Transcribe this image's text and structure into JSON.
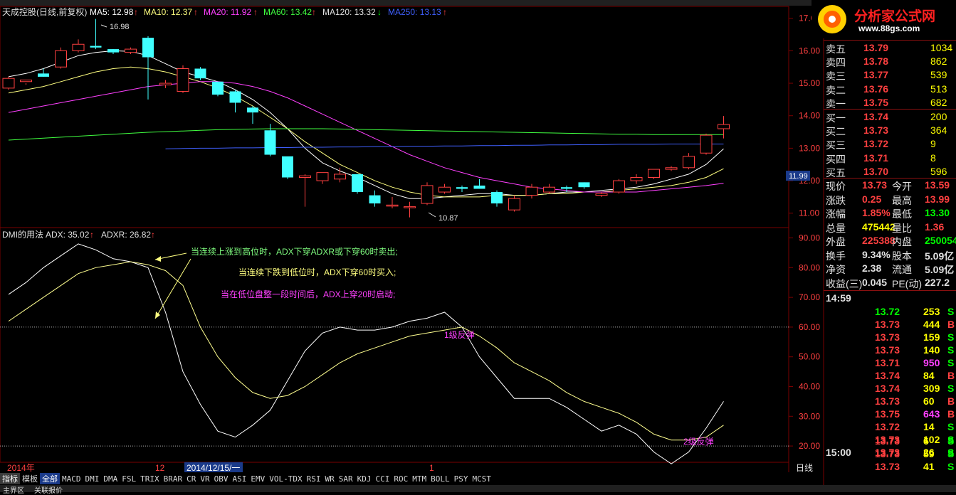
{
  "window": {
    "main_title_prefix": "天成控股(日线,前复权)",
    "ma5": "MA5: 12.98",
    "ma10": "MA10: 12.37",
    "ma20": "MA20: 11.92",
    "ma60": "MA60: 13.42",
    "ma120": "MA120: 13.32",
    "ma250": "MA250: 13.13",
    "sub_title": "DMI的用法",
    "adx": "ADX: 35.02",
    "adxr": "ADXR: 26.82"
  },
  "logo": {
    "text": "分析家公式网",
    "url": "www.88gs.com"
  },
  "annotations": {
    "max_price": "16.98",
    "min_price": "10.87",
    "cur_price_tag": "11.99",
    "note1": "当连续上涨到高位时，ADX下穿ADXR或下穿60时卖出;",
    "note2": "当连续下跌到低位时，ADX下穿60时买入;",
    "note3": "当在低位盘整一段时间后，ADX上穿20时启动;",
    "label_fantan1": "1级反弹",
    "label_fantan2": "2级反弹"
  },
  "axis": {
    "price_ticks": [
      "17.00",
      "16.00",
      "15.00",
      "14.00",
      "13.00",
      "12.00",
      "11.00"
    ],
    "dmi_ticks": [
      "90.00",
      "80.00",
      "70.00",
      "60.00",
      "50.00",
      "40.00",
      "30.00",
      "20.00"
    ],
    "x_labels": {
      "year": "2014年",
      "month12": "12",
      "date_sel": "2014/12/15/一",
      "month1": "1",
      "period": "日线"
    }
  },
  "toolbar": [
    "指标",
    "模板",
    "全部",
    "MACD",
    "DMI",
    "DMA",
    "FSL",
    "TRIX",
    "BRAR",
    "CR",
    "VR",
    "OBV",
    "ASI",
    "EMV",
    "VOL-TDX",
    "RSI",
    "WR",
    "SAR",
    "KDJ",
    "CCI",
    "ROC",
    "MTM",
    "BOLL",
    "PSY",
    "MCST"
  ],
  "bottombar": {
    "left1": "主界区",
    "left2": "关联报价"
  },
  "quote": {
    "sell": [
      {
        "label": "卖五",
        "price": "13.79",
        "vol": "1034"
      },
      {
        "label": "卖四",
        "price": "13.78",
        "vol": "862"
      },
      {
        "label": "卖三",
        "price": "13.77",
        "vol": "539"
      },
      {
        "label": "卖二",
        "price": "13.76",
        "vol": "513"
      },
      {
        "label": "卖一",
        "price": "13.75",
        "vol": "682"
      }
    ],
    "buy": [
      {
        "label": "买一",
        "price": "13.74",
        "vol": "200"
      },
      {
        "label": "买二",
        "price": "13.73",
        "vol": "364"
      },
      {
        "label": "买三",
        "price": "13.72",
        "vol": "9"
      },
      {
        "label": "买四",
        "price": "13.71",
        "vol": "8"
      },
      {
        "label": "买五",
        "price": "13.70",
        "vol": "596"
      }
    ],
    "stats": [
      {
        "l1": "现价",
        "v1": "13.73",
        "l2": "今开",
        "v2": "13.59",
        "c1": "#ff4040",
        "c2": "#ff4040"
      },
      {
        "l1": "涨跌",
        "v1": "0.25",
        "l2": "最高",
        "v2": "13.99",
        "c1": "#ff4040",
        "c2": "#ff4040"
      },
      {
        "l1": "涨幅",
        "v1": "1.85%",
        "l2": "最低",
        "v2": "13.30",
        "c1": "#ff4040",
        "c2": "#00ff00"
      },
      {
        "l1": "总量",
        "v1": "475442",
        "l2": "量比",
        "v2": "1.36",
        "c1": "#ffff00",
        "c2": "#ff4040"
      },
      {
        "l1": "外盘",
        "v1": "225388",
        "l2": "内盘",
        "v2": "250054",
        "c1": "#ff4040",
        "c2": "#00ff00"
      },
      {
        "l1": "换手",
        "v1": "9.34%",
        "l2": "股本",
        "v2": "5.09亿",
        "c1": "#e0e0e0",
        "c2": "#e0e0e0"
      },
      {
        "l1": "净资",
        "v1": "2.38",
        "l2": "流通",
        "v2": "5.09亿",
        "c1": "#e0e0e0",
        "c2": "#e0e0e0"
      },
      {
        "l1": "收益(三)",
        "v1": "0.045",
        "l2": "PE(动)",
        "v2": "227.2",
        "c1": "#e0e0e0",
        "c2": "#e0e0e0"
      }
    ],
    "ticks_time1": "14:59",
    "ticks_time2": "15:00",
    "ticks": [
      {
        "p": "13.72",
        "v": "253",
        "s": "S",
        "pc": "#00ff00",
        "vc": "#ffff00",
        "sc": "#00ff00"
      },
      {
        "p": "13.73",
        "v": "444",
        "s": "B",
        "pc": "#ff4040",
        "vc": "#ffff00",
        "sc": "#ff4040"
      },
      {
        "p": "13.73",
        "v": "159",
        "s": "S",
        "pc": "#ff4040",
        "vc": "#ffff00",
        "sc": "#00ff00"
      },
      {
        "p": "13.73",
        "v": "140",
        "s": "S",
        "pc": "#ff4040",
        "vc": "#ffff00",
        "sc": "#00ff00"
      },
      {
        "p": "13.71",
        "v": "950",
        "s": "S",
        "pc": "#ff4040",
        "vc": "#ff40ff",
        "sc": "#00ff00"
      },
      {
        "p": "13.74",
        "v": "84",
        "s": "B",
        "pc": "#ff4040",
        "vc": "#ffff00",
        "sc": "#ff4040"
      },
      {
        "p": "13.74",
        "v": "309",
        "s": "S",
        "pc": "#ff4040",
        "vc": "#ffff00",
        "sc": "#00ff00"
      },
      {
        "p": "13.73",
        "v": "60",
        "s": "B",
        "pc": "#ff4040",
        "vc": "#ffff00",
        "sc": "#ff4040"
      },
      {
        "p": "13.75",
        "v": "643",
        "s": "B",
        "pc": "#ff4040",
        "vc": "#ff40ff",
        "sc": "#ff4040"
      },
      {
        "p": "13.72",
        "v": "14",
        "s": "S",
        "pc": "#ff4040",
        "vc": "#ffff00",
        "sc": "#00ff00"
      },
      {
        "p": "13.73",
        "v": "102",
        "s": "S",
        "pc": "#ff4040",
        "vc": "#ffff00",
        "sc": "#00ff00"
      },
      {
        "p": "13.73",
        "v": "26",
        "s": "S",
        "pc": "#ff4040",
        "vc": "#ffff00",
        "sc": "#00ff00"
      },
      {
        "p": "13.73",
        "v": "6",
        "s": "S",
        "pc": "#ff4040",
        "vc": "#ffff00",
        "sc": "#00ff00"
      },
      {
        "p": "13.73",
        "v": "59",
        "s": "S",
        "pc": "#ff4040",
        "vc": "#ffff00",
        "sc": "#00ff00"
      },
      {
        "p": "13.73",
        "v": "41",
        "s": "S",
        "pc": "#ff4040",
        "vc": "#ffff00",
        "sc": "#00ff00"
      }
    ]
  },
  "chart_data": [
    {
      "type": "candlestick",
      "ylim": [
        10.6,
        17.3
      ],
      "series": [
        {
          "name": "K",
          "candles": [
            [
              14.85,
              15.2,
              14.8,
              15.15
            ],
            [
              15.05,
              15.0,
              14.95,
              15.1
            ],
            [
              15.3,
              15.45,
              15.2,
              15.2
            ],
            [
              15.5,
              16.1,
              15.45,
              16.0
            ],
            [
              16.0,
              16.35,
              15.95,
              16.2
            ],
            [
              16.15,
              16.98,
              16.05,
              16.1
            ],
            [
              16.05,
              16.05,
              15.9,
              15.95
            ],
            [
              15.95,
              16.1,
              15.9,
              16.05
            ],
            [
              16.4,
              16.45,
              14.5,
              15.8
            ],
            [
              14.95,
              15.1,
              14.85,
              15.0
            ],
            [
              14.75,
              15.55,
              14.7,
              15.45
            ],
            [
              15.45,
              15.5,
              15.1,
              15.15
            ],
            [
              15.05,
              15.0,
              14.6,
              14.65
            ],
            [
              14.75,
              14.8,
              14.1,
              14.4
            ],
            [
              14.25,
              14.3,
              13.75,
              14.1
            ],
            [
              13.55,
              13.75,
              12.75,
              12.8
            ],
            [
              12.75,
              12.7,
              12.05,
              12.1
            ],
            [
              12.1,
              12.2,
              11.2,
              12.15
            ],
            [
              12.0,
              12.2,
              11.9,
              12.25
            ],
            [
              12.05,
              12.4,
              11.95,
              12.2
            ],
            [
              12.2,
              12.2,
              11.6,
              11.65
            ],
            [
              11.55,
              11.7,
              11.2,
              11.3
            ],
            [
              11.25,
              11.5,
              11.15,
              11.25
            ],
            [
              11.2,
              11.35,
              10.87,
              11.2
            ],
            [
              11.3,
              11.95,
              11.25,
              11.85
            ],
            [
              11.65,
              11.9,
              11.6,
              11.8
            ],
            [
              11.8,
              11.85,
              11.65,
              11.75
            ],
            [
              11.85,
              12.05,
              11.75,
              11.75
            ],
            [
              11.65,
              11.7,
              11.2,
              11.3
            ],
            [
              11.1,
              11.55,
              11.05,
              11.45
            ],
            [
              11.55,
              11.9,
              11.45,
              11.8
            ],
            [
              11.65,
              11.9,
              11.6,
              11.8
            ],
            [
              11.8,
              11.85,
              11.65,
              11.75
            ],
            [
              11.95,
              11.95,
              11.75,
              11.8
            ],
            [
              11.55,
              11.65,
              11.5,
              11.6
            ],
            [
              11.65,
              12.05,
              11.6,
              12.0
            ],
            [
              12.0,
              12.2,
              11.9,
              12.1
            ],
            [
              12.1,
              12.35,
              12.05,
              12.35
            ],
            [
              12.35,
              12.45,
              12.3,
              12.4
            ],
            [
              12.4,
              12.85,
              12.35,
              12.75
            ],
            [
              12.85,
              13.45,
              12.8,
              13.4
            ],
            [
              13.6,
              13.99,
              13.3,
              13.73
            ]
          ]
        },
        {
          "name": "MA5",
          "values": [
            15.2,
            15.3,
            15.45,
            15.65,
            15.85,
            15.95,
            16.0,
            15.98,
            15.85,
            15.6,
            15.35,
            15.2,
            15.05,
            14.8,
            14.5,
            14.1,
            13.6,
            13.0,
            12.55,
            12.3,
            12.1,
            11.85,
            11.6,
            11.45,
            11.45,
            11.5,
            11.55,
            11.6,
            11.6,
            11.55,
            11.55,
            11.6,
            11.65,
            11.65,
            11.7,
            11.75,
            11.8,
            11.9,
            12.05,
            12.2,
            12.5,
            12.98
          ]
        },
        {
          "name": "MA10",
          "values": [
            14.7,
            14.8,
            14.9,
            15.05,
            15.2,
            15.35,
            15.45,
            15.5,
            15.45,
            15.35,
            15.2,
            15.05,
            14.85,
            14.6,
            14.3,
            13.95,
            13.6,
            13.2,
            12.85,
            12.5,
            12.25,
            12.0,
            11.8,
            11.65,
            11.55,
            11.5,
            11.5,
            11.5,
            11.55,
            11.55,
            11.55,
            11.6,
            11.6,
            11.65,
            11.65,
            11.7,
            11.75,
            11.8,
            11.85,
            11.95,
            12.1,
            12.37
          ]
        },
        {
          "name": "MA20",
          "values": [
            14.1,
            14.2,
            14.3,
            14.4,
            14.5,
            14.6,
            14.7,
            14.8,
            14.9,
            14.95,
            15.0,
            15.05,
            15.05,
            15.0,
            14.9,
            14.75,
            14.55,
            14.3,
            14.05,
            13.8,
            13.55,
            13.3,
            13.05,
            12.8,
            12.6,
            12.4,
            12.25,
            12.1,
            12.0,
            11.9,
            11.8,
            11.75,
            11.7,
            11.65,
            11.65,
            11.65,
            11.65,
            11.7,
            11.75,
            11.8,
            11.85,
            11.92
          ]
        },
        {
          "name": "MA60",
          "values": [
            13.25,
            13.28,
            13.31,
            13.34,
            13.37,
            13.4,
            13.43,
            13.46,
            13.49,
            13.51,
            13.53,
            13.55,
            13.57,
            13.58,
            13.59,
            13.6,
            13.6,
            13.6,
            13.6,
            13.59,
            13.58,
            13.57,
            13.56,
            13.55,
            13.54,
            13.53,
            13.52,
            13.51,
            13.5,
            13.49,
            13.48,
            13.47,
            13.46,
            13.45,
            13.44,
            13.43,
            13.43,
            13.42,
            13.42,
            13.42,
            13.42,
            13.42
          ]
        },
        {
          "name": "MA250",
          "values": [
            null,
            null,
            null,
            null,
            null,
            null,
            null,
            null,
            null,
            12.98,
            12.99,
            13.0,
            13.0,
            13.01,
            13.01,
            13.02,
            13.02,
            13.03,
            13.03,
            13.04,
            13.04,
            13.05,
            13.05,
            13.06,
            13.06,
            13.07,
            13.07,
            13.08,
            13.08,
            13.09,
            13.09,
            13.1,
            13.1,
            13.11,
            13.11,
            13.12,
            13.12,
            13.12,
            13.13,
            13.13,
            13.13,
            13.13
          ]
        }
      ]
    },
    {
      "type": "line",
      "ylim": [
        15,
        93
      ],
      "reference_lines": [
        60,
        20
      ],
      "series": [
        {
          "name": "ADX",
          "values": [
            71,
            75,
            80,
            84,
            88,
            86,
            83,
            82,
            80,
            65,
            45,
            34,
            25,
            23,
            27,
            32,
            42,
            52,
            58,
            60,
            59,
            59,
            60,
            62,
            63,
            65,
            60,
            50,
            43,
            36,
            36,
            36,
            33,
            29,
            25,
            27,
            24,
            18,
            14,
            18,
            26,
            35
          ]
        },
        {
          "name": "ADXR",
          "values": [
            62,
            66,
            70,
            74,
            78,
            80,
            81,
            82,
            81,
            79,
            74,
            60,
            50,
            43,
            38,
            36,
            37,
            40,
            44,
            48,
            51,
            53,
            55,
            57,
            58,
            59,
            60,
            57,
            53,
            48,
            45,
            42,
            38,
            35,
            33,
            31,
            28,
            24,
            22,
            22,
            23,
            27
          ]
        }
      ]
    }
  ]
}
